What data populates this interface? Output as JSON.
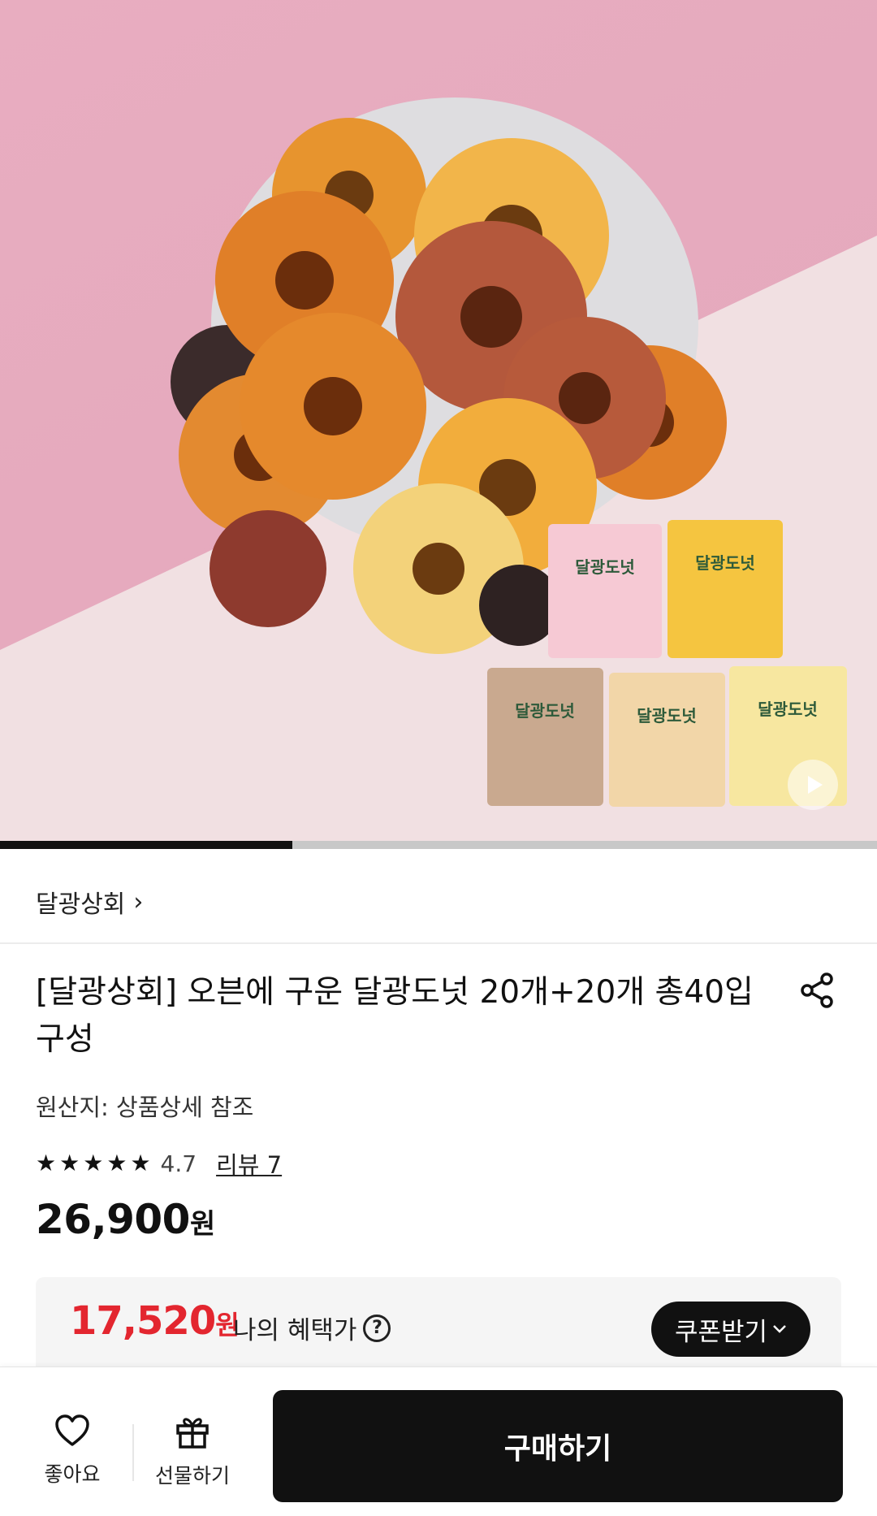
{
  "hero": {
    "image_alt": "",
    "slide_progress": 0.333,
    "bg_color": "#e5a9bd",
    "package_labels": [
      "달광도넛",
      "달광도넛",
      "달광도넛",
      "달광도넛",
      "달광도넛"
    ]
  },
  "store": {
    "name": "달광상회",
    "chevron": "›"
  },
  "product": {
    "title": "[달광상회] 오븐에 구운 달광도넛 20개+20개 총40입 구성",
    "origin": "원산지: 상품상세 참조",
    "rating": {
      "stars": 4.7,
      "score_text": "4.7",
      "review_text": "리뷰 7"
    },
    "price": {
      "amount": "26,900",
      "unit": "원"
    }
  },
  "benefit": {
    "price": {
      "amount": "17,520",
      "unit": "원",
      "color": "#e3262f"
    },
    "label": "나의 혜택가",
    "help_icon": "?",
    "coupon_button": "쿠폰받기"
  },
  "bottom_bar": {
    "like_label": "좋아요",
    "gift_label": "선물하기",
    "buy_label": "구매하기"
  }
}
